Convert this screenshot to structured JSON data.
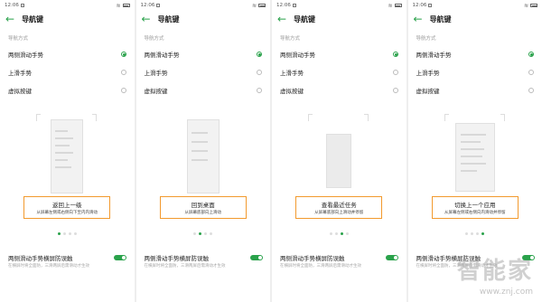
{
  "screens": [
    {
      "status_time": "12:06",
      "title": "导航键",
      "section": "导航方式",
      "options": [
        {
          "label": "两侧滑动手势",
          "selected": true
        },
        {
          "label": "上滑手势",
          "selected": false
        },
        {
          "label": "虚拟按键",
          "selected": false
        }
      ],
      "caption_title": "返回上一级",
      "caption_sub": "从屏幕左侧或右侧向下至内内滑动",
      "active_dot": 0,
      "toggle_label": "两侧滑动手势横屏防误触",
      "toggle_desc": "在横屏时将全面防，三滑两屏后需滑动才生效",
      "toggle_on": true
    },
    {
      "status_time": "12:06",
      "title": "导航键",
      "section": "导航方式",
      "options": [
        {
          "label": "两侧滑动手势",
          "selected": true
        },
        {
          "label": "上滑手势",
          "selected": false
        },
        {
          "label": "虚拟按键",
          "selected": false
        }
      ],
      "caption_title": "回到桌面",
      "caption_sub": "从屏幕底部向上滑动",
      "active_dot": 1,
      "toggle_label": "两侧滑动手势横屏防误触",
      "toggle_desc": "在横屏时将全面防，三滑两屏后需滑动才生效",
      "toggle_on": true
    },
    {
      "status_time": "12:06",
      "title": "导航键",
      "section": "导航方式",
      "options": [
        {
          "label": "两侧滑动手势",
          "selected": true
        },
        {
          "label": "上滑手势",
          "selected": false
        },
        {
          "label": "虚拟按键",
          "selected": false
        }
      ],
      "caption_title": "查看最近任务",
      "caption_sub": "从屏幕底部向上滑动并停留",
      "active_dot": 2,
      "toggle_label": "两侧滑动手势横屏防误触",
      "toggle_desc": "在横屏时将全面防，三滑两屏后需滑动才生效",
      "toggle_on": true
    },
    {
      "status_time": "12:06",
      "title": "导航键",
      "section": "导航方式",
      "options": [
        {
          "label": "两侧滑动手势",
          "selected": true
        },
        {
          "label": "上滑手势",
          "selected": false
        },
        {
          "label": "虚拟按键",
          "selected": false
        }
      ],
      "caption_title": "切换上一个应用",
      "caption_sub": "从屏幕左侧或右侧向内滑动并停留",
      "active_dot": 3,
      "toggle_label": "两侧滑动手势横屏防误触",
      "toggle_desc": "在横屏时将全面防，三滑两屏后需滑动才生效",
      "toggle_on": true
    }
  ],
  "watermark": {
    "main": "智能家",
    "sub": "www.znj.com"
  },
  "colors": {
    "accent": "#2aa24b",
    "highlight_border": "#f29a2e"
  }
}
